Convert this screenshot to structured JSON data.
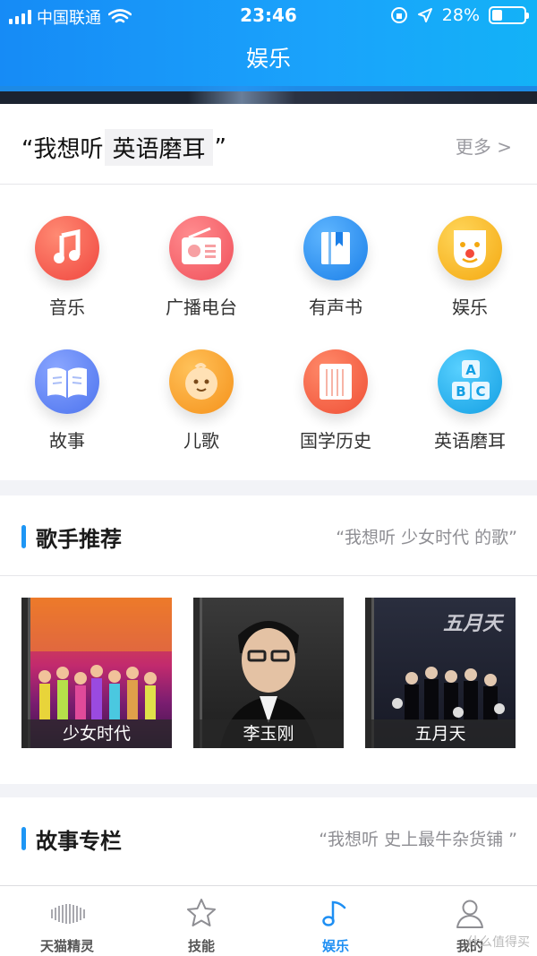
{
  "status": {
    "carrier": "中国联通",
    "time": "23:46",
    "battery": "28%"
  },
  "title": "娱乐",
  "prompt": {
    "prefix": "“我想听",
    "highlight": "英语磨耳",
    "suffix": "”",
    "more": "更多 >"
  },
  "categories": [
    {
      "label": "音乐",
      "icon": "music-note-icon",
      "color": "#f2564e"
    },
    {
      "label": "广播电台",
      "icon": "radio-icon",
      "color": "#f5636a"
    },
    {
      "label": "有声书",
      "icon": "book-icon",
      "color": "#2d8ef0"
    },
    {
      "label": "娱乐",
      "icon": "clown-face-icon",
      "color": "#f6b81a"
    },
    {
      "label": "故事",
      "icon": "open-book-icon",
      "color": "#5a7ff0"
    },
    {
      "label": "儿歌",
      "icon": "baby-face-icon",
      "color": "#f7a020"
    },
    {
      "label": "国学历史",
      "icon": "scroll-icon",
      "color": "#f4644a"
    },
    {
      "label": "英语磨耳",
      "icon": "abc-blocks-icon",
      "color": "#20b2ee"
    }
  ],
  "singers": {
    "title": "歌手推荐",
    "hint": "“我想听 少女时代 的歌”",
    "items": [
      {
        "name": "少女时代",
        "image": "girl-group-photo"
      },
      {
        "name": "李玉刚",
        "image": "man-portrait-photo"
      },
      {
        "name": "五月天",
        "image": "band-photo"
      }
    ]
  },
  "stories": {
    "title": "故事专栏",
    "hint": "“我想听 史上最牛杂货铺 ”"
  },
  "tabs": [
    {
      "label": "天猫精灵",
      "icon": "waveform-icon",
      "active": false
    },
    {
      "label": "技能",
      "icon": "star-icon",
      "active": false
    },
    {
      "label": "娱乐",
      "icon": "music-note-icon",
      "active": true
    },
    {
      "label": "我的",
      "icon": "person-icon",
      "active": false
    }
  ],
  "watermark": "什么值得买"
}
